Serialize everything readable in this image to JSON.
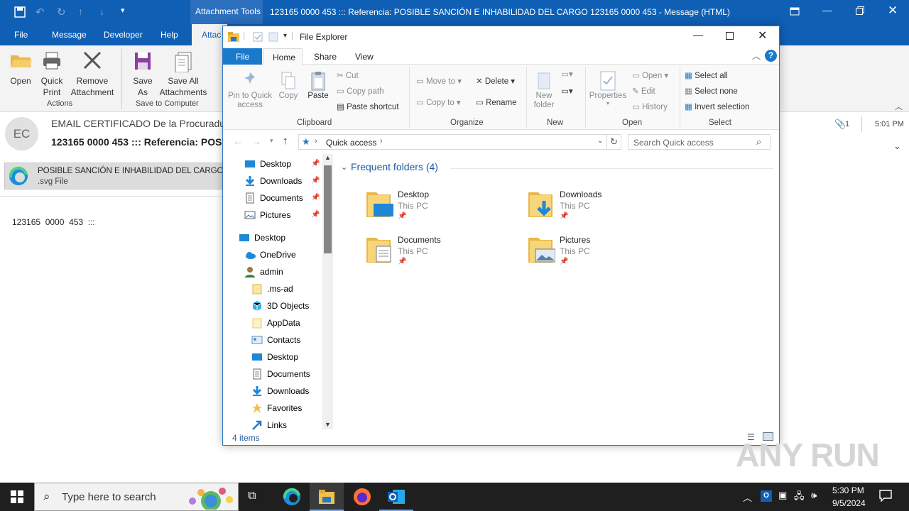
{
  "outlook": {
    "contextual_tab": "Attachment Tools",
    "title": "123165 0000 453 ::: Referencia: POSIBLE SANCIÓN E INHABILIDAD DEL CARGO 123165 0000 453  -  Message (HTML)",
    "tabs": [
      "File",
      "Message",
      "Developer",
      "Help",
      "Attac"
    ],
    "ribbon": {
      "open": "Open",
      "quick_print": [
        "Quick",
        "Print"
      ],
      "remove_attachment": [
        "Remove",
        "Attachment"
      ],
      "save_as": [
        "Save",
        "As"
      ],
      "save_all": [
        "Save All",
        "Attachments"
      ],
      "group_actions": "Actions",
      "group_save": "Save to Computer"
    },
    "avatar": "EC",
    "from": "EMAIL CERTIFICADO De la Procuradu",
    "subject": "123165 0000 453 ::: Referencia: POSI",
    "attachment_name": "POSIBLE SANCIÓN  E INHABILIDAD DEL CARGO.s",
    "attachment_type": ".svg File",
    "attachment_count": "1",
    "time": "5:01 PM",
    "body": "123165  0000  453  :::"
  },
  "explorer": {
    "title": "File Explorer",
    "tabs": [
      "File",
      "Home",
      "Share",
      "View"
    ],
    "clipboard": {
      "pin": [
        "Pin to Quick",
        "access"
      ],
      "copy": "Copy",
      "paste": "Paste",
      "cut": "Cut",
      "copy_path": "Copy path",
      "paste_shortcut": "Paste shortcut",
      "label": "Clipboard"
    },
    "organize": {
      "move_to": "Move to",
      "copy_to": "Copy to",
      "delete": "Delete",
      "rename": "Rename",
      "label": "Organize"
    },
    "new": {
      "new_folder": [
        "New",
        "folder"
      ],
      "label": "New"
    },
    "open": {
      "properties": "Properties",
      "open": "Open",
      "edit": "Edit",
      "history": "History",
      "label": "Open"
    },
    "select": {
      "select_all": "Select all",
      "select_none": "Select none",
      "invert": "Invert selection",
      "label": "Select"
    },
    "address": "Quick access",
    "search_placeholder": "Search Quick access",
    "nav_pinned": [
      "Desktop",
      "Downloads",
      "Documents",
      "Pictures"
    ],
    "nav_tree": [
      "Desktop",
      "OneDrive",
      "admin",
      ".ms-ad",
      "3D Objects",
      "AppData",
      "Contacts",
      "Desktop",
      "Documents",
      "Downloads",
      "Favorites",
      "Links"
    ],
    "group_header": "Frequent folders (4)",
    "folders": [
      {
        "name": "Desktop",
        "location": "This PC"
      },
      {
        "name": "Downloads",
        "location": "This PC"
      },
      {
        "name": "Documents",
        "location": "This PC"
      },
      {
        "name": "Pictures",
        "location": "This PC"
      }
    ],
    "status": "4 items"
  },
  "taskbar": {
    "search_placeholder": "Type here to search",
    "time": "5:30 PM",
    "date": "9/5/2024"
  },
  "watermark": "ANY RUN",
  "colors": {
    "outlook_blue": "#0f5fb5",
    "explorer_accent": "#0078d7",
    "taskbar": "#1f1f1f"
  }
}
